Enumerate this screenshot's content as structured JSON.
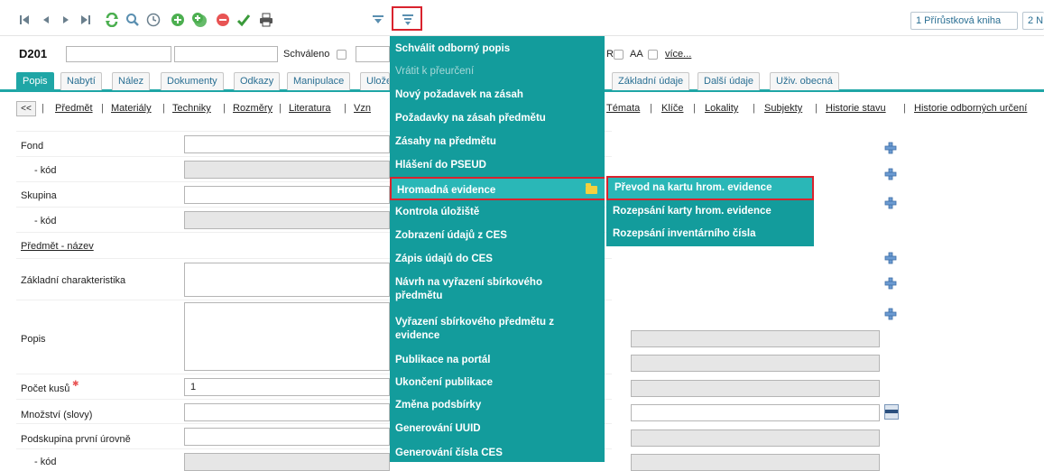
{
  "toolbar": {
    "icons": [
      "first-icon",
      "prev-icon",
      "next-icon",
      "last-icon",
      "refresh-icon",
      "search-icon",
      "clock-icon",
      "add-icon",
      "copy-icon",
      "delete-icon",
      "check-icon",
      "print-icon",
      "filter-icon",
      "filter-menu-icon"
    ],
    "right_buttons": [
      "1 Přírůstková kniha",
      "2 N"
    ]
  },
  "record": {
    "code": "D201",
    "schvaleno_label": "Schváleno",
    "r_label": "R",
    "aa_label": "AA",
    "vice_link": "více..."
  },
  "tabs": [
    "Popis",
    "Nabytí",
    "Nález",
    "Dokumenty",
    "Odkazy",
    "Manipulace",
    "Uložen",
    "Základní údaje",
    "Další údaje",
    "Uživ. obecná"
  ],
  "subnav": {
    "back": "<<",
    "left_links": [
      "Předmět",
      "Materiály",
      "Techniky",
      "Rozměry",
      "Literatura",
      "Vzn"
    ],
    "right_links": [
      "Témata",
      "Klíče",
      "Lokality",
      "Subjekty",
      "Historie stavu",
      "Historie odborných určení"
    ]
  },
  "form": {
    "fond": "Fond",
    "fond_kod": "- kód",
    "skupina": "Skupina",
    "skupina_kod": "- kód",
    "predmet_nazev": "Předmět - název",
    "zakladni_char": "Základní charakteristika",
    "popis": "Popis",
    "pocet_kusu": "Počet kusů",
    "pocet_kusu_value": "1",
    "mnozstvi": "Množství (slovy)",
    "podskupina": "Podskupina první úrovně",
    "last_kod": "- kód"
  },
  "menu": {
    "items": [
      "Schválit odborný popis",
      "Vrátit k přeurčení",
      "Nový požadavek na zásah",
      "Požadavky na zásah předmětu",
      "Zásahy na předmětu",
      "Hlášení do PSEUD",
      "Hromadná evidence",
      "Kontrola úložiště",
      "Zobrazení údajů z CES",
      "Zápis údajů do CES",
      "Návrh na vyřazení sbírkového předmětu",
      "Vyřazení sbírkového předmětu z evidence",
      "Publikace na portál",
      "Ukončení publikace",
      "Změna podsbírky",
      "Generování UUID",
      "Generování čísla CES"
    ],
    "disabled_item": "Vrátit k přeurčení",
    "highlighted_item": "Hromadná evidence"
  },
  "submenu": {
    "items": [
      "Převod na kartu hrom. evidence",
      "Rozepsání karty hrom. evidence",
      "Rozepsání inventárního čísla"
    ]
  },
  "colors": {
    "teal": "#139c9c",
    "teal_hover": "#2ab7b7",
    "tab_active": "#1fa6a6",
    "highlight_red": "#d9232e",
    "link_blue": "#2a6f93"
  }
}
